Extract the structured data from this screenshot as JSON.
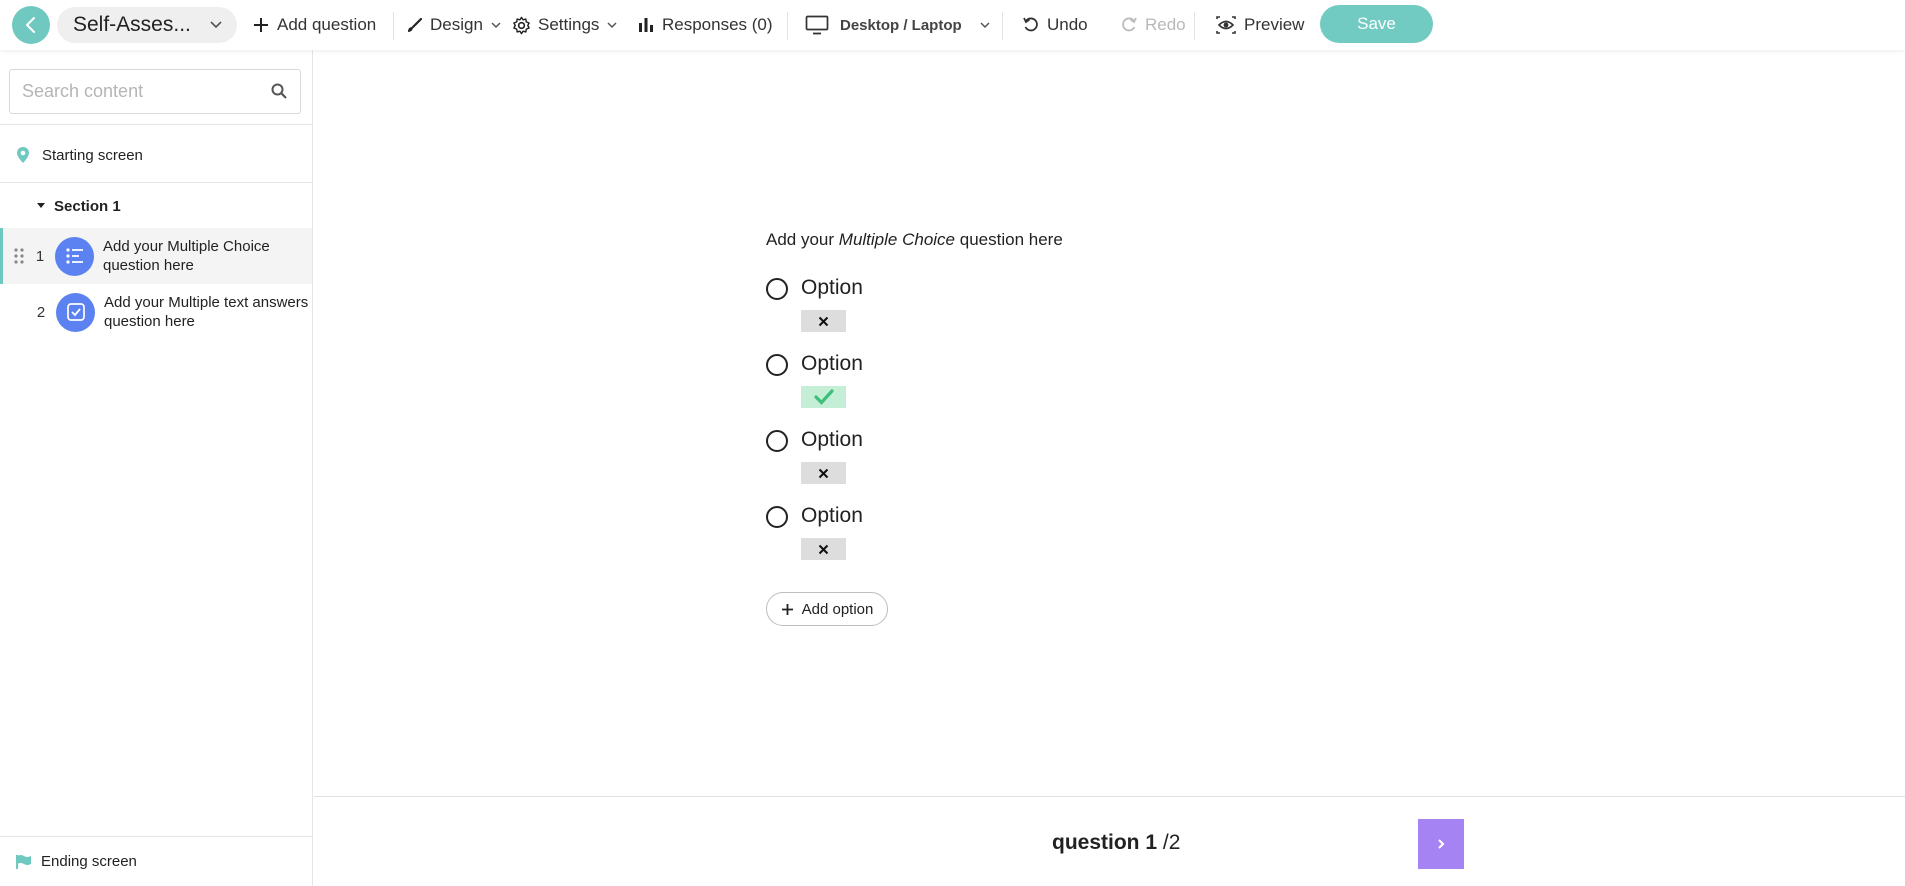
{
  "toolbar": {
    "title": "Self-Asses...",
    "add_question": "Add question",
    "design": "Design",
    "settings": "Settings",
    "responses": "Responses (0)",
    "device": "Desktop / Laptop",
    "undo": "Undo",
    "redo": "Redo",
    "preview": "Preview",
    "save": "Save"
  },
  "sidebar": {
    "search_placeholder": "Search content",
    "starting_screen": "Starting screen",
    "section": "Section 1",
    "questions": [
      {
        "number": "1",
        "line1": "Add your Multiple Choice",
        "line2": "question here",
        "icon": "list-icon",
        "active": true
      },
      {
        "number": "2",
        "line1": "Add your Multiple text answers",
        "line2": "question here",
        "icon": "checkbox-icon",
        "active": false
      }
    ],
    "ending_screen": "Ending screen"
  },
  "main": {
    "question_prefix": "Add your",
    "question_italic": "Multiple Choice",
    "question_suffix": "question here",
    "options": [
      {
        "label": "Option",
        "correct": false
      },
      {
        "label": "Option",
        "correct": true
      },
      {
        "label": "Option",
        "correct": false
      },
      {
        "label": "Option",
        "correct": false
      }
    ],
    "add_option": "Add option"
  },
  "footer": {
    "counter_word": "question",
    "current": "1",
    "total": "/2"
  },
  "colors": {
    "accent": "#6fc9c0",
    "question_icon": "#5b82f0",
    "next_button": "#a583f3",
    "correct_bg": "#c4eed6",
    "wrong_bg": "#dddddd"
  }
}
